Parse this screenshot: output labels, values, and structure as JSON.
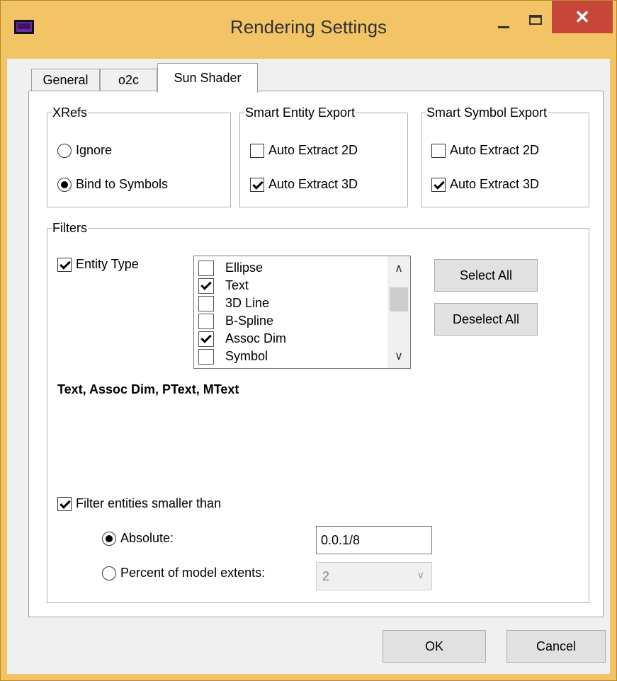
{
  "window": {
    "title": "Rendering Settings",
    "minimize_glyph": "",
    "close_glyph": "✕"
  },
  "tabs": [
    {
      "label": "General",
      "active": false
    },
    {
      "label": "o2c",
      "active": false
    },
    {
      "label": "Sun Shader",
      "active": true
    }
  ],
  "xrefs": {
    "legend": "XRefs",
    "options": [
      {
        "label": "Ignore",
        "selected": false
      },
      {
        "label": "Bind to Symbols",
        "selected": true
      }
    ]
  },
  "smart_entity_export": {
    "legend": "Smart Entity Export",
    "auto_2d": {
      "label": "Auto Extract 2D",
      "checked": false
    },
    "auto_3d": {
      "label": "Auto Extract 3D",
      "checked": true
    }
  },
  "smart_symbol_export": {
    "legend": "Smart Symbol Export",
    "auto_2d": {
      "label": "Auto Extract 2D",
      "checked": false
    },
    "auto_3d": {
      "label": "Auto Extract 3D",
      "checked": true
    }
  },
  "filters": {
    "legend": "Filters",
    "entity_type": {
      "label": "Entity Type",
      "checked": true
    },
    "entity_list": [
      {
        "label": "Ellipse",
        "checked": false
      },
      {
        "label": "Text",
        "checked": true
      },
      {
        "label": "3D Line",
        "checked": false
      },
      {
        "label": "B-Spline",
        "checked": false
      },
      {
        "label": "Assoc Dim",
        "checked": true
      },
      {
        "label": "Symbol",
        "checked": false
      }
    ],
    "select_all_label": "Select All",
    "deselect_all_label": "Deselect All",
    "selection_summary": "Text, Assoc Dim, PText, MText",
    "filter_small": {
      "label": "Filter entities smaller than",
      "checked": true
    },
    "absolute": {
      "label": "Absolute:",
      "selected": true,
      "value": "0.0.1/8"
    },
    "percent": {
      "label": "Percent of model extents:",
      "selected": false,
      "value": "2"
    }
  },
  "buttons": {
    "ok_label": "OK",
    "cancel_label": "Cancel"
  },
  "colors": {
    "frame": "#f2c466",
    "close": "#c7463a",
    "client": "#f0f0f0"
  }
}
